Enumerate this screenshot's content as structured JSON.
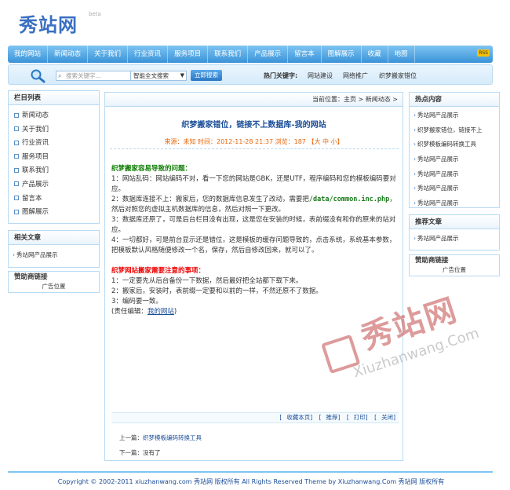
{
  "logo": {
    "text": "秀站网",
    "sup": "beta"
  },
  "nav": {
    "items": [
      "我的网站",
      "新闻动态",
      "关于我们",
      "行业资讯",
      "服务项目",
      "联系我们",
      "产品展示",
      "留言本",
      "图解展示",
      "收藏",
      "地图"
    ],
    "badge": "RSS"
  },
  "search": {
    "placeholder": "搜索关键字...",
    "select": "智能全文搜索",
    "button": "立即搜索",
    "hot_label": "热门关键字:",
    "hot_links": [
      "网站建设",
      "网络推广",
      "织梦搬家错位"
    ]
  },
  "left": {
    "cat_title": "栏目列表",
    "cats": [
      "新闻动态",
      "关于我们",
      "行业资讯",
      "服务项目",
      "联系我们",
      "产品展示",
      "留言本",
      "图解展示"
    ],
    "related_title": "相关文章",
    "related": [
      "秀站网产品展示"
    ],
    "sponsor_title": "赞助商链接",
    "sponsor_text": "广告位置"
  },
  "main": {
    "breadcrumb": "当前位置：主页 > 新闻动态 >",
    "title": "织梦搬家错位，链接不上数据库-我的网站",
    "meta": "来源：未知   时间：2012-11-28 21:37   浏览：187     【大 中 小】",
    "h1": "织梦搬家容易导致的问题：",
    "p1": "1：网站乱码：网站编码不对，看一下您的网站是GBK，还是UTF，程序编码和您的模板编码要对应。",
    "p2a": "2：数据库连接不上：搬家后，您的数据库信息发生了改动，需要把",
    "p2code": "/data/common.inc.php",
    "p2b": "，然后对照您的虚拟主机数据库的信息，然后对照一下更改。",
    "p3": "3：数据库还原了，可是后台栏目没有出现，这是您在安装的时候，表前缀没有和你的原来的站对应。",
    "p4": "4：一切都好，可是前台显示还是错位，这是模板的缓存问题导致的，点击系统，系统基本参数，把模板默认风格随便修改一个名，保存，然后自修改回来，就可以了。",
    "h2": "织梦网站搬家需要注意的事项：",
    "q1": "1：一定要先从后台备份一下数据，然后最好把全站都下载下来。",
    "q2": "2：搬家后，安装时，表前缀一定要和以前的一样，不然还原不了数据。",
    "q3": "3：编码要一致。",
    "editor_pre": "(责任编辑：",
    "editor_link": "我的网站",
    "editor_post": ")",
    "tools": [
      "收藏本页",
      "推荐",
      "打印",
      "关闭"
    ],
    "prev_label": "上一篇：",
    "prev_link": "织梦模板编码转换工具",
    "next_label": "下一篇：",
    "next_text": "没有了"
  },
  "right": {
    "hot_title": "热点内容",
    "hot": [
      "秀站网产品展示",
      "织梦搬家错位，链接不上",
      "织梦模板编码转换工具",
      "秀站网产品展示",
      "秀站网产品展示",
      "秀站网产品展示",
      "秀站网产品展示"
    ],
    "rec_title": "推荐文章",
    "rec": [
      "秀站网产品展示"
    ],
    "sponsor_title": "赞助商链接",
    "sponsor_text": "广告位置"
  },
  "watermark": {
    "big": "秀站网",
    "small": "Xiuzhanwang.Com"
  },
  "footer": "Copyright © 2002-2011 xiuzhanwang.com 秀站网  版权所有   All Rights Reserved Theme by Xiuzhanwang.Com 秀站网  版权所有"
}
